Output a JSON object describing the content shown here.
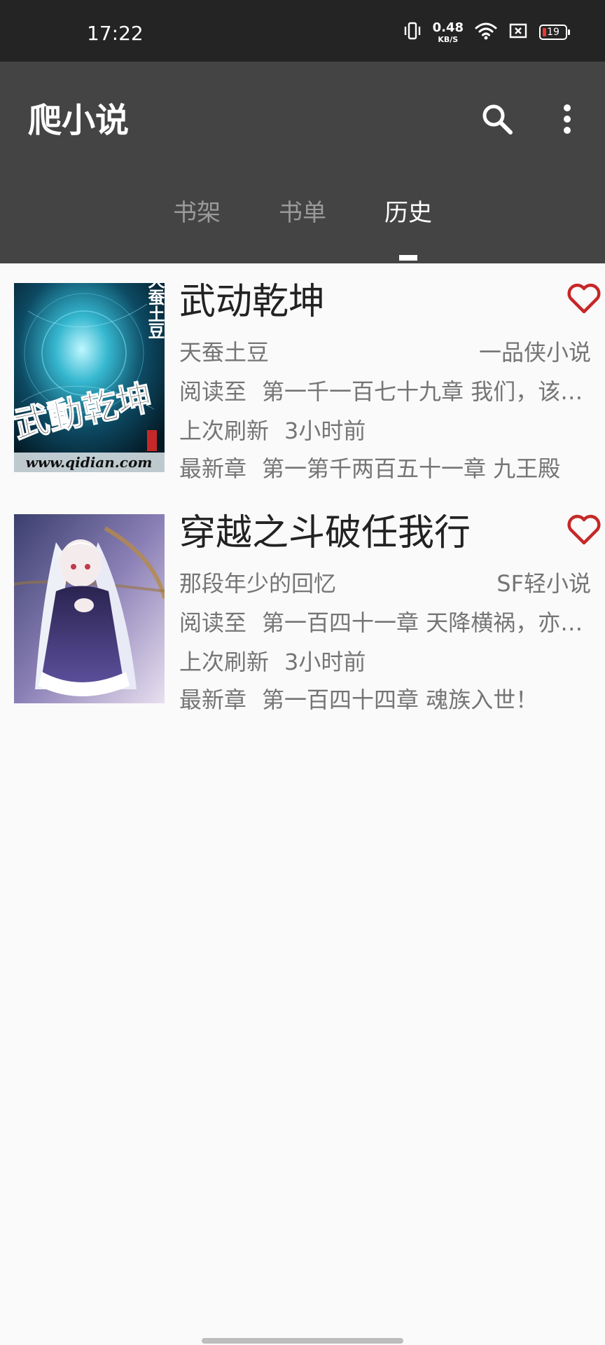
{
  "status_bar": {
    "time": "17:22",
    "net_speed": "0.48",
    "net_unit": "KB/S",
    "battery": "19"
  },
  "app_bar": {
    "title": "爬小说",
    "icons": [
      "search-icon",
      "more-vert-icon"
    ]
  },
  "tabs": [
    {
      "label": "书架",
      "active": false
    },
    {
      "label": "书单",
      "active": false
    },
    {
      "label": "历史",
      "active": true
    }
  ],
  "books": [
    {
      "title": "武动乾坤",
      "author": "天蚕土豆",
      "source": "一品侠小说",
      "read_label": "阅读至",
      "read_chapter": "第一千一百七十九章 我们，该…",
      "refresh_label": "上次刷新",
      "refresh_time": "3小时前",
      "latest_label": "最新章",
      "latest_chapter": "第一第千两百五十一章 九王殿",
      "cover_text_vertical": "天蚕土豆",
      "cover_text_main": "武動乾坤",
      "cover_site": "www.qidian.com"
    },
    {
      "title": "穿越之斗破任我行",
      "author": "那段年少的回忆",
      "source": "SF轻小说",
      "read_label": "阅读至",
      "read_chapter": "第一百四十一章 天降横祸，亦…",
      "refresh_label": "上次刷新",
      "refresh_time": "3小时前",
      "latest_label": "最新章",
      "latest_chapter": "第一百四十四章 魂族入世！"
    }
  ],
  "colors": {
    "status_bar": "#242424",
    "app_bar": "#444444",
    "favorite": "#c62828",
    "background": "#fafafa"
  }
}
